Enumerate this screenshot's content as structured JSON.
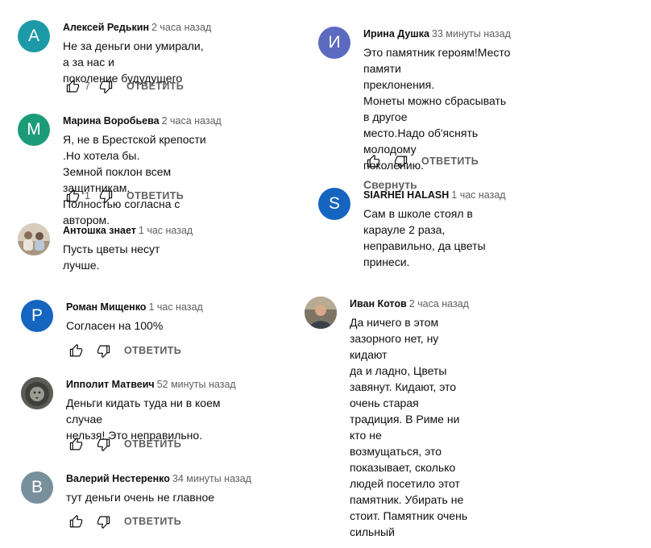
{
  "actions": {
    "reply_label": "ОТВЕТИТЬ",
    "collapse_label": "Свернуть"
  },
  "comments": [
    {
      "author": "Алексей Редькин",
      "time": "2 часа назад",
      "avatar_letter": "А",
      "avatar_color": "#1d9aa8",
      "text": "Не за деньги они умирали, а за нас и\nпоколение будудущего",
      "likes": "7"
    },
    {
      "author": "Марина Воробьева",
      "time": "2 часа назад",
      "avatar_letter": "М",
      "avatar_color": "#1c9b78",
      "text": "Я, не в Брестской крепости .Но хотела бы.\nЗемной поклон всем защитникам.\nПолностью согласна  с автором.",
      "likes": "1"
    },
    {
      "author": "Антошка знает",
      "time": "1 час назад",
      "avatar_letter": "",
      "avatar_color": "#c7b7a3",
      "text": "Пусть цветы несут лучше.",
      "likes": ""
    },
    {
      "author": "Роман Мищенко",
      "time": "1 час назад",
      "avatar_letter": "Р",
      "avatar_color": "#1565c0",
      "text": "Согласен на 100%",
      "likes": ""
    },
    {
      "author": "Ипполит Матвеич",
      "time": "52 минуты назад",
      "avatar_letter": "",
      "avatar_color": "#6e6e66",
      "text": "Деньги кидать туда ни в коем случае\nнельзя! Это неправильно.",
      "likes": ""
    },
    {
      "author": "Валерий Нестеренко",
      "time": "34 минуты назад",
      "avatar_letter": "В",
      "avatar_color": "#78909c",
      "text": "тут деньги очень не главное",
      "likes": ""
    },
    {
      "author": "Ирина Душка",
      "time": "33 минуты назад",
      "avatar_letter": "И",
      "avatar_color": "#5c6bc0",
      "text": "Это памятник героям!Место памяти\nпреклонения.\nМонеты можно сбрасывать в другое\nместо.Надо об'яснять молодому\nпоколению.",
      "likes": ""
    },
    {
      "author": "SIARHEI HALASH",
      "time": "1 час назад",
      "avatar_letter": "S",
      "avatar_color": "#1565c0",
      "text": "Сам в школе стоял в карауле 2 раза,\nнеправильно, да цветы принеси.",
      "likes": ""
    },
    {
      "author": "Иван Котов",
      "time": "2 часа назад",
      "avatar_letter": "",
      "avatar_color": "#9a8874",
      "text": "Да ничего в этом зазорного нет, ну кидают\nда и ладно, Цветы завянут. Кидают, это\nочень старая традиция. В Риме ни кто не\nвозмущаться, это показывает, сколько\nлюдей посетило этот памятник. Убирать не\nстоит. Памятник очень сильный",
      "likes": ""
    }
  ]
}
